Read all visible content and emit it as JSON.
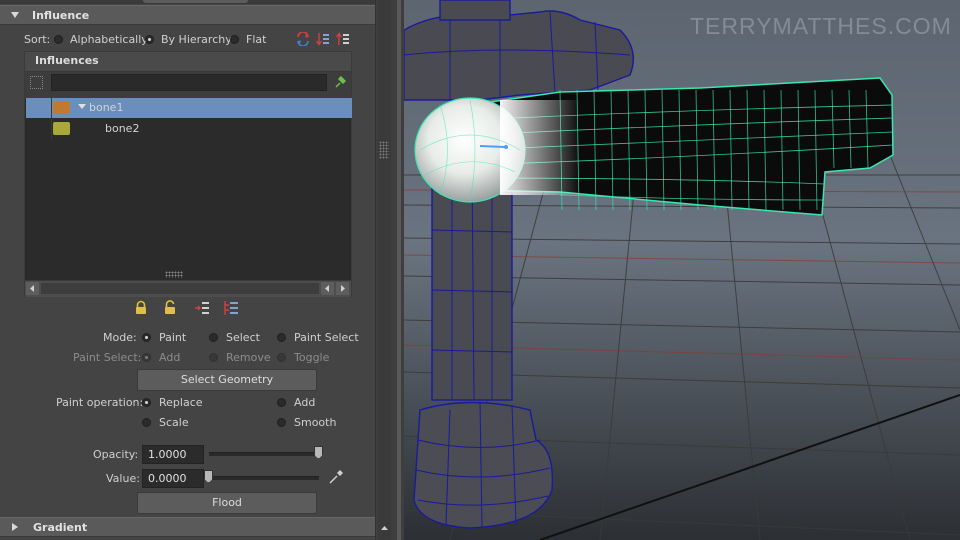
{
  "influence_panel": {
    "title": "Influence",
    "sort": {
      "label": "Sort:",
      "options": [
        "Alphabetically",
        "By Hierarchy",
        "Flat"
      ],
      "selected": "By Hierarchy"
    },
    "influences_list": {
      "header": "Influences",
      "search_value": "",
      "items": [
        {
          "name": "bone1",
          "color": "#c07a30",
          "selected": true,
          "expanded": true
        },
        {
          "name": "bone2",
          "color": "#a9a93a",
          "selected": false
        }
      ]
    },
    "mode": {
      "label": "Mode:",
      "options": [
        "Paint",
        "Select",
        "Paint Select"
      ],
      "selected": "Paint"
    },
    "paint_select": {
      "label": "Paint Select:",
      "options": [
        "Add",
        "Remove",
        "Toggle"
      ],
      "selected": "Add"
    },
    "select_geometry_label": "Select Geometry",
    "paint_operation": {
      "label": "Paint operation:",
      "options": [
        "Replace",
        "Add",
        "Scale",
        "Smooth"
      ],
      "selected": "Replace"
    },
    "opacity": {
      "label": "Opacity:",
      "value": "1.0000",
      "slider_fraction": 1.0
    },
    "value": {
      "label": "Value:",
      "value": "0.0000",
      "slider_fraction": 0.0
    },
    "flood_label": "Flood"
  },
  "gradient_section": {
    "title": "Gradient"
  },
  "viewport": {
    "watermark": "TERRYMATTHES.COM"
  },
  "colors": {
    "panel_bg": "#444444",
    "selection_blue": "#6b8fbd",
    "wire_blue": "#1a1a9c",
    "wire_green": "#38e8b0",
    "grid_red": "#8a3a30"
  }
}
